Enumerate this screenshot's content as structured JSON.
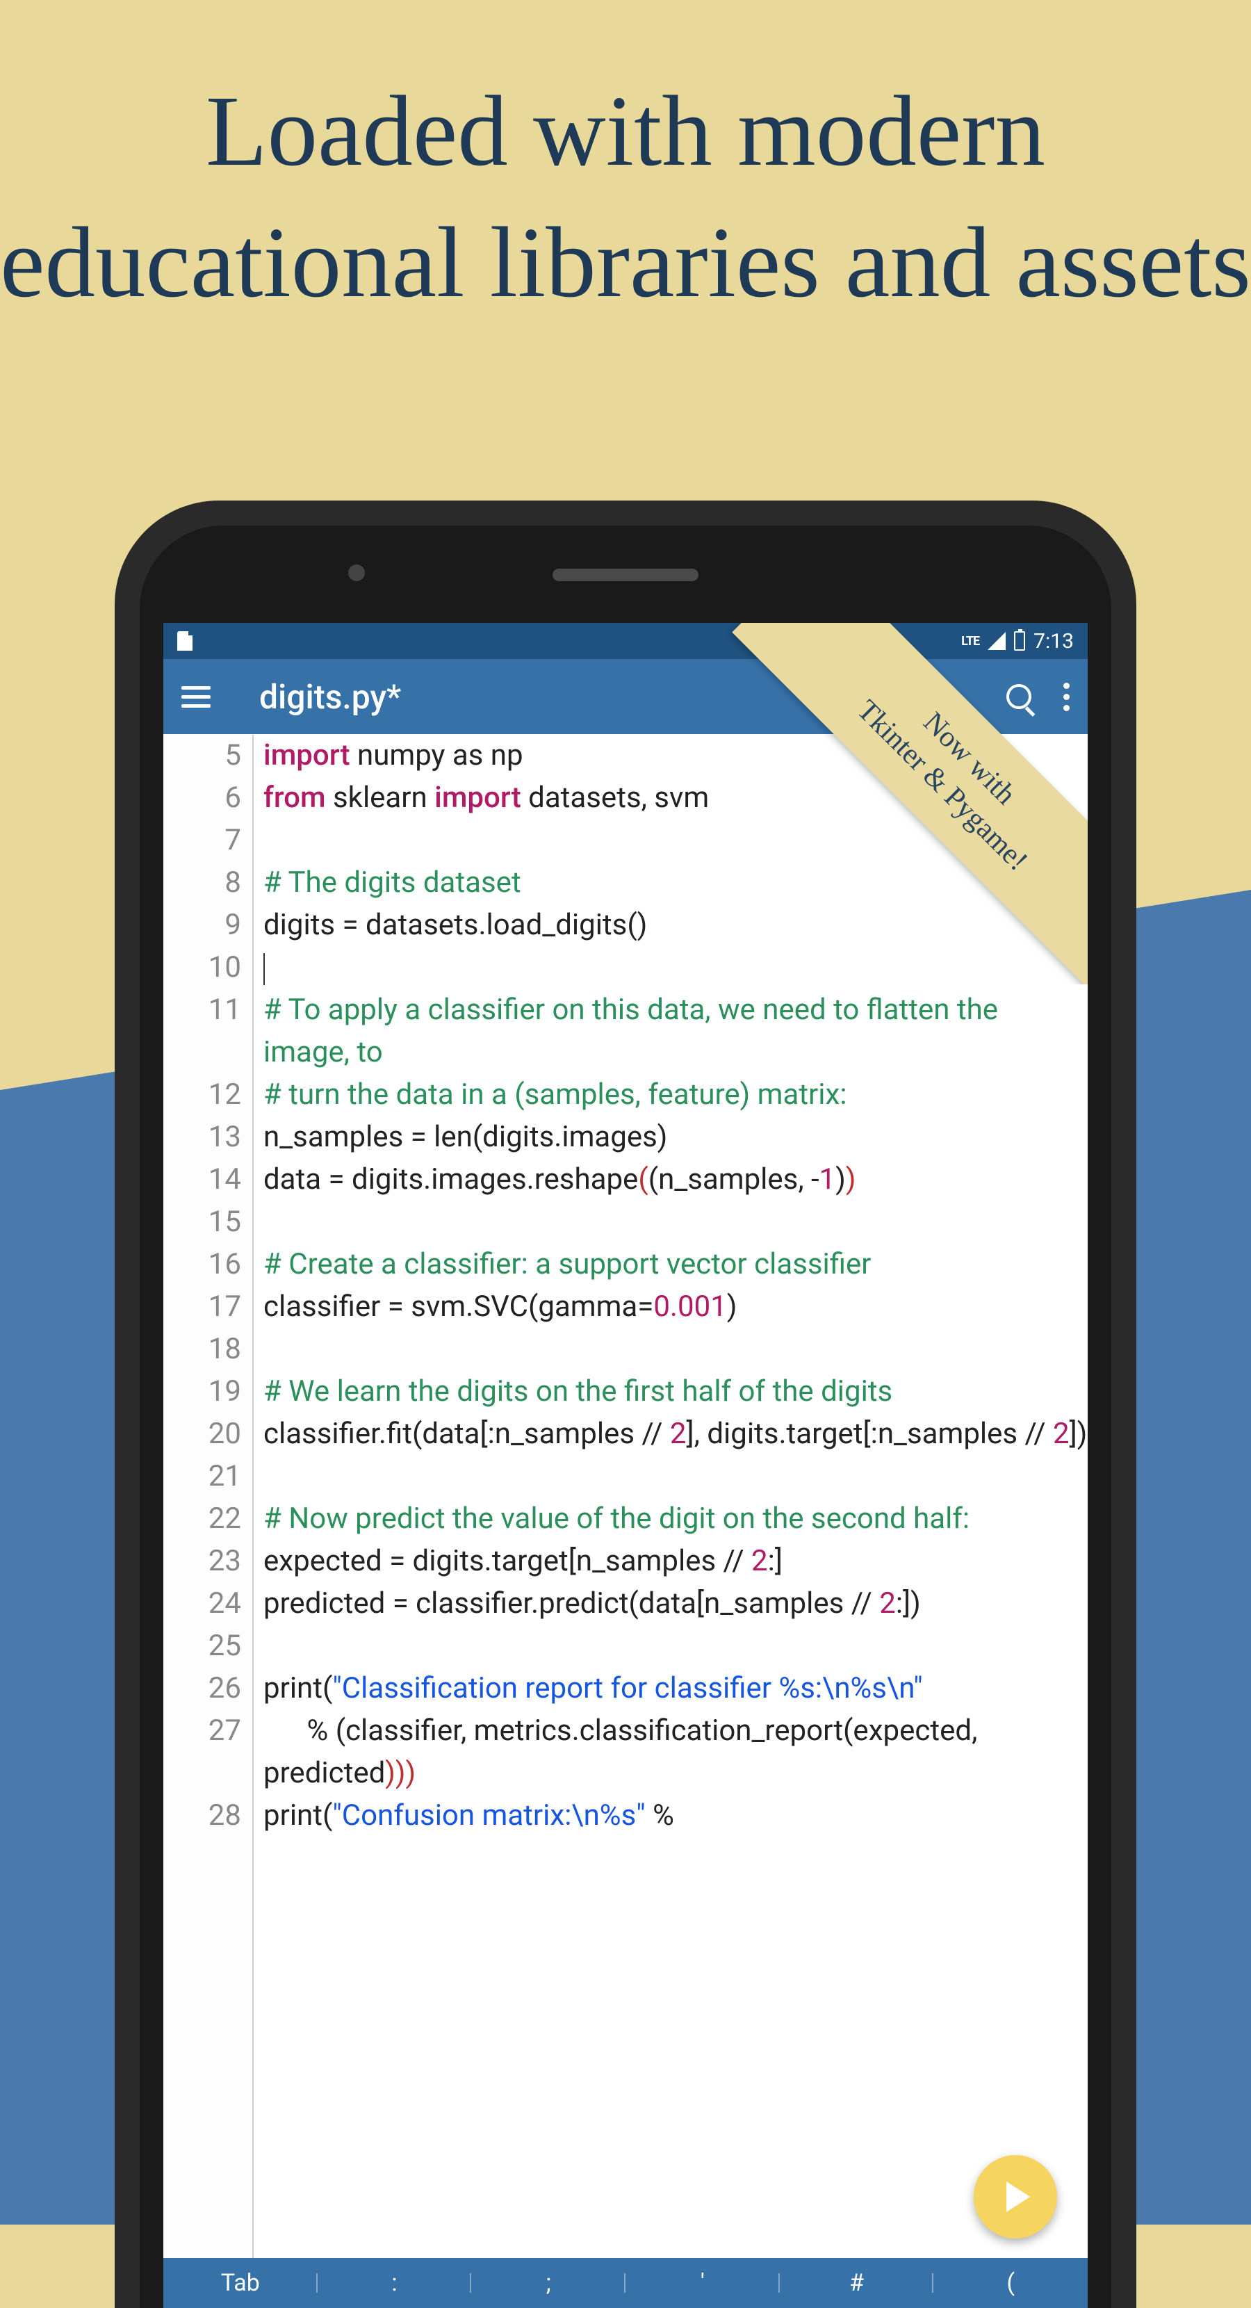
{
  "marketing": {
    "headline": "Loaded with modern educational libraries and assets",
    "ribbon_line1": "Now with",
    "ribbon_line2": "Tkinter & Pygame!"
  },
  "status": {
    "network": "LTE",
    "time": "7:13"
  },
  "appbar": {
    "title": "digits.py*"
  },
  "code_lines": [
    {
      "n": 5,
      "parts": [
        {
          "c": "kw",
          "t": "import"
        },
        {
          "t": " numpy as np"
        }
      ]
    },
    {
      "n": 6,
      "parts": [
        {
          "c": "kw",
          "t": "from"
        },
        {
          "t": " sklearn "
        },
        {
          "c": "kw",
          "t": "import"
        },
        {
          "t": " datasets, svm"
        }
      ]
    },
    {
      "n": 7,
      "parts": []
    },
    {
      "n": 8,
      "parts": [
        {
          "c": "cm",
          "t": "# The digits dataset"
        }
      ]
    },
    {
      "n": 9,
      "parts": [
        {
          "t": "digits = datasets.load_digits()"
        }
      ]
    },
    {
      "n": 10,
      "parts": [
        {
          "cursor": true
        }
      ]
    },
    {
      "n": 11,
      "parts": [
        {
          "c": "cm",
          "t": "# To apply a classifier on this data, we need to flatten the image, to"
        }
      ]
    },
    {
      "n": 12,
      "parts": [
        {
          "c": "cm",
          "t": "# turn the data in a (samples, feature) matrix:"
        }
      ]
    },
    {
      "n": 13,
      "parts": [
        {
          "t": "n_samples = len(digits.images)"
        }
      ]
    },
    {
      "n": 14,
      "parts": [
        {
          "t": "data = digits.images.reshape"
        },
        {
          "c": "pr",
          "t": "("
        },
        {
          "t": "(n_samples, -"
        },
        {
          "c": "num",
          "t": "1"
        },
        {
          "t": ")"
        },
        {
          "c": "pr",
          "t": ")"
        }
      ]
    },
    {
      "n": 15,
      "parts": []
    },
    {
      "n": 16,
      "parts": [
        {
          "c": "cm",
          "t": "# Create a classifier: a support vector classifier"
        }
      ]
    },
    {
      "n": 17,
      "parts": [
        {
          "t": "classifier = svm.SVC(gamma="
        },
        {
          "c": "num",
          "t": "0.001"
        },
        {
          "t": ")"
        }
      ]
    },
    {
      "n": 18,
      "parts": []
    },
    {
      "n": 19,
      "parts": [
        {
          "c": "cm",
          "t": "# We learn the digits on the first half of the digits"
        }
      ]
    },
    {
      "n": 20,
      "parts": [
        {
          "t": "classifier.fit(data[:n_samples // "
        },
        {
          "c": "num",
          "t": "2"
        },
        {
          "t": "], digits.target[:n_samples // "
        },
        {
          "c": "num",
          "t": "2"
        },
        {
          "t": "])"
        }
      ]
    },
    {
      "n": 21,
      "parts": []
    },
    {
      "n": 22,
      "parts": [
        {
          "c": "cm",
          "t": "# Now predict the value of the digit on the second half:"
        }
      ]
    },
    {
      "n": 23,
      "parts": [
        {
          "t": "expected = digits.target[n_samples // "
        },
        {
          "c": "num",
          "t": "2"
        },
        {
          "t": ":]"
        }
      ]
    },
    {
      "n": 24,
      "parts": [
        {
          "t": "predicted = classifier.predict(data[n_samples // "
        },
        {
          "c": "num",
          "t": "2"
        },
        {
          "t": ":])"
        }
      ]
    },
    {
      "n": 25,
      "parts": []
    },
    {
      "n": 26,
      "parts": [
        {
          "t": "print("
        },
        {
          "c": "str",
          "t": "\"Classification report for classifier %s:\\n%s\\n\""
        }
      ]
    },
    {
      "n": 27,
      "parts": [
        {
          "t": "      % (classifier, metrics.classification_report(expected, predicted"
        },
        {
          "c": "pr",
          "t": ")))"
        }
      ]
    },
    {
      "n": 28,
      "parts": [
        {
          "t": "print("
        },
        {
          "c": "str",
          "t": "\"Confusion matrix:\\n%s\""
        },
        {
          "t": " %"
        }
      ]
    }
  ],
  "keyboard_row": [
    "Tab",
    ":",
    ";",
    "'",
    "#",
    "("
  ]
}
